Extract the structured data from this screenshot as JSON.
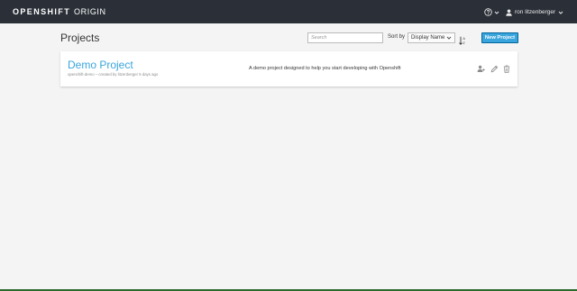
{
  "navbar": {
    "brand_bold": "OPENSHIFT",
    "brand_light": "ORIGIN",
    "user_name": "ron litzenberger"
  },
  "header": {
    "title": "Projects",
    "search_placeholder": "Search",
    "sort_label": "Sort by",
    "sort_value": "Display Name",
    "new_project_label": "New Project"
  },
  "projects": [
    {
      "display_name": "Demo Project",
      "meta": "openshift-demo – created by litzenberger 5 days ago",
      "description": "A demo project designed to help you start developing with Openshift"
    }
  ],
  "colors": {
    "navbar": "#2b3038",
    "accent": "#39a5dc",
    "page_bg": "#f4f4f4"
  },
  "icons": [
    "help-icon",
    "user-icon",
    "chevron-down-icon",
    "sort-direction-icon",
    "members-icon",
    "edit-icon",
    "delete-icon"
  ]
}
